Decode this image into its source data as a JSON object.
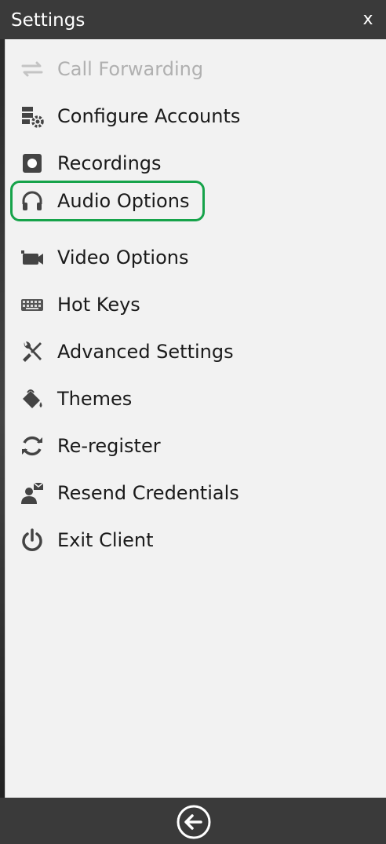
{
  "window": {
    "title": "Settings",
    "close_label": "x"
  },
  "menu": {
    "items": [
      {
        "label": "Call Forwarding",
        "icon": "call-forward-icon",
        "enabled": false
      },
      {
        "label": "Configure Accounts",
        "icon": "configure-accounts-icon",
        "enabled": true
      },
      {
        "label": "Recordings",
        "icon": "recordings-icon",
        "enabled": true
      },
      {
        "label": "Audio Options",
        "icon": "headphones-icon",
        "enabled": true,
        "selected": true
      },
      {
        "label": "Video Options",
        "icon": "video-camera-icon",
        "enabled": true
      },
      {
        "label": "Hot Keys",
        "icon": "keyboard-icon",
        "enabled": true
      },
      {
        "label": "Advanced Settings",
        "icon": "tools-icon",
        "enabled": true
      },
      {
        "label": "Themes",
        "icon": "paint-bucket-icon",
        "enabled": true
      },
      {
        "label": "Re-register",
        "icon": "refresh-icon",
        "enabled": true
      },
      {
        "label": "Resend Credentials",
        "icon": "resend-credentials-icon",
        "enabled": true
      },
      {
        "label": "Exit Client",
        "icon": "power-icon",
        "enabled": true
      }
    ]
  },
  "footer": {
    "back_icon": "back-arrow-icon"
  },
  "colors": {
    "titlebar": "#3a3a3a",
    "panel": "#f2f2f2",
    "highlight": "#16a34a",
    "icon": "#444444",
    "disabled": "#b0b0b0"
  }
}
